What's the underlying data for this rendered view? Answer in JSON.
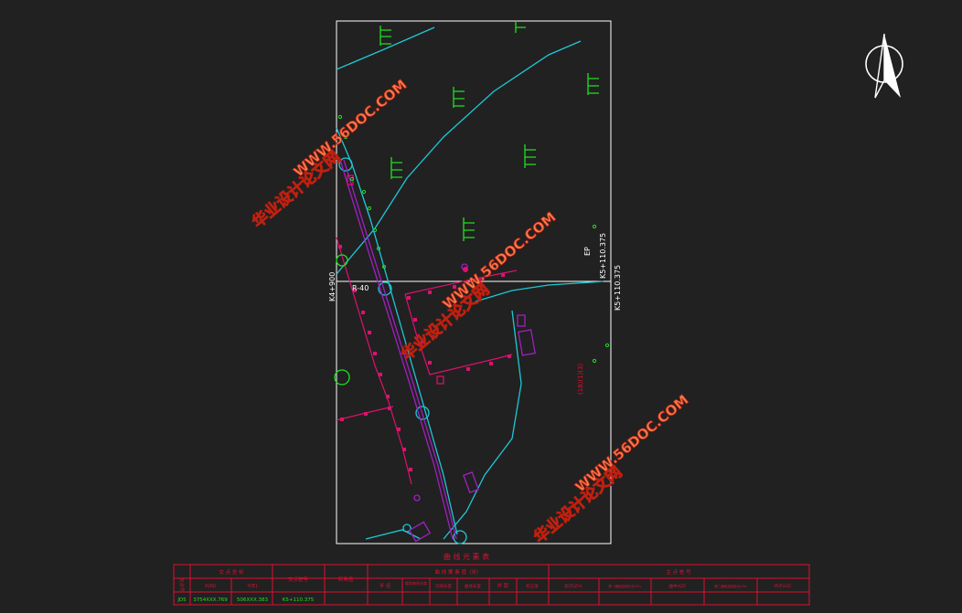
{
  "drawing": {
    "station_labels": {
      "left_vertical": "K4+900",
      "right_upper": "K5+110.375",
      "right_lower": "K5+110.375",
      "radius": "R-40",
      "ep": "EP",
      "red_annotation": "(18)(1)(3)"
    }
  },
  "watermarks": [
    {
      "line1": "华业设计论文网",
      "line2": "WWW.56DOC.COM"
    },
    {
      "line1": "华业设计论文网",
      "line2": "WWW.56DOC.COM"
    },
    {
      "line1": "华业设计论文网",
      "line2": "WWW.56DOC.COM"
    }
  ],
  "table": {
    "title": "曲 线 元 素 表",
    "headers": {
      "point_no": "交点号",
      "coords": "交 点 坐 标",
      "x": "X(N)",
      "y": "Y(E)",
      "station": "交点桩号",
      "angle": "转角值",
      "curve_elements": "曲 线 要 素 值（米）",
      "sub": [
        "半 径",
        "缓和曲线长度",
        "切线长度",
        "曲线长度",
        "外 距",
        "校正值"
      ],
      "main_points": "主 点 桩 号",
      "points": [
        "起点(ZH)",
        "第一缓和曲线终点(HY)",
        "曲中(QZ)",
        "第二缓和曲线起点(YH)",
        "终点(HZ)"
      ]
    },
    "rows": [
      {
        "no": "JD5",
        "x": "3754XXX.769",
        "y": "506XXX.383",
        "station": "K5+110.375"
      }
    ]
  },
  "colors": {
    "background": "#212121",
    "frame": "#ffffff",
    "cyan": "#1ec8d6",
    "magenta": "#e0106e",
    "purple": "#a020c0",
    "green": "#20e020",
    "table": "#e01030",
    "watermark_fill": "#f08050",
    "watermark_stroke": "#c02010"
  }
}
